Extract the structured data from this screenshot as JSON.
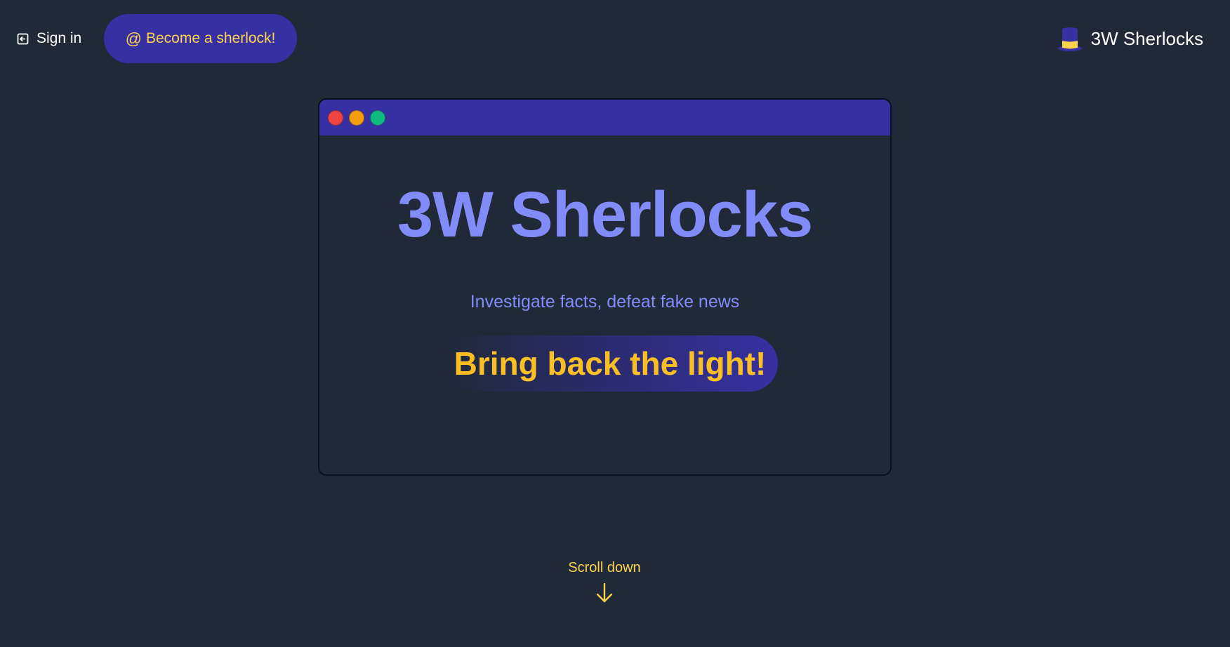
{
  "header": {
    "signin_label": "Sign in",
    "become_label": "Become a sherlock!",
    "brand_name": "3W Sherlocks"
  },
  "hero": {
    "title": "3W Sherlocks",
    "subtitle": "Investigate facts, defeat fake news",
    "cta": "Bring back the light!"
  },
  "scroll": {
    "label": "Scroll down"
  },
  "colors": {
    "background": "#1f2937",
    "accent_indigo": "#3730a3",
    "title_indigo": "#818cf8",
    "amber": "#fbbf24",
    "window_red": "#ef4444",
    "window_yellow": "#f59e0b",
    "window_green": "#10b981"
  },
  "icons": {
    "signin": "sign-in-icon",
    "become": "at-icon",
    "brand": "top-hat-icon",
    "scroll": "arrow-down-icon"
  }
}
